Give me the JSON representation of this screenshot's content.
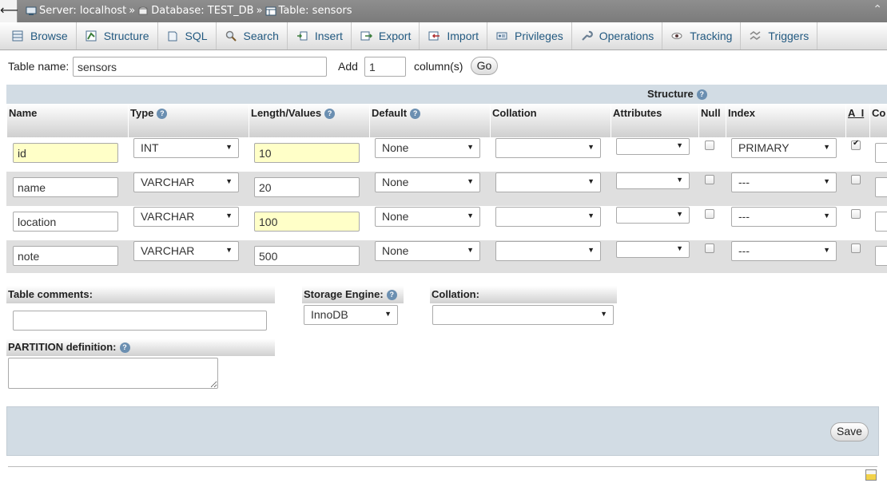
{
  "breadcrumb": {
    "server": "Server: localhost",
    "database": "Database: TEST_DB",
    "table": "Table: sensors",
    "sep": "»"
  },
  "tabs": [
    {
      "label": "Browse",
      "icon": "browse-icon"
    },
    {
      "label": "Structure",
      "icon": "structure-icon"
    },
    {
      "label": "SQL",
      "icon": "sql-icon"
    },
    {
      "label": "Search",
      "icon": "search-icon"
    },
    {
      "label": "Insert",
      "icon": "insert-icon"
    },
    {
      "label": "Export",
      "icon": "export-icon"
    },
    {
      "label": "Import",
      "icon": "import-icon"
    },
    {
      "label": "Privileges",
      "icon": "privileges-icon"
    },
    {
      "label": "Operations",
      "icon": "operations-icon"
    },
    {
      "label": "Tracking",
      "icon": "tracking-icon"
    },
    {
      "label": "Triggers",
      "icon": "triggers-icon"
    }
  ],
  "table_name": {
    "label": "Table name:",
    "value": "sensors",
    "add_label": "Add",
    "add_count": "1",
    "columns_label": "column(s)",
    "go_label": "Go"
  },
  "structure": {
    "caption": "Structure",
    "headers": {
      "name": "Name",
      "type": "Type",
      "length": "Length/Values",
      "default": "Default",
      "collation": "Collation",
      "attributes": "Attributes",
      "null": "Null",
      "index": "Index",
      "ai": "A_I",
      "comments": "Co"
    },
    "rows": [
      {
        "name": "id",
        "type": "INT",
        "length": "10",
        "default": "None",
        "collation": "",
        "attributes": "",
        "null": false,
        "index": "PRIMARY",
        "ai": true
      },
      {
        "name": "name",
        "type": "VARCHAR",
        "length": "20",
        "default": "None",
        "collation": "",
        "attributes": "",
        "null": false,
        "index": "---",
        "ai": false
      },
      {
        "name": "location",
        "type": "VARCHAR",
        "length": "100",
        "default": "None",
        "collation": "",
        "attributes": "",
        "null": false,
        "index": "---",
        "ai": false
      },
      {
        "name": "note",
        "type": "VARCHAR",
        "length": "500",
        "default": "None",
        "collation": "",
        "attributes": "",
        "null": false,
        "index": "---",
        "ai": false
      }
    ]
  },
  "table_comments": {
    "label": "Table comments:",
    "value": ""
  },
  "storage_engine": {
    "label": "Storage Engine:",
    "value": "InnoDB"
  },
  "collation": {
    "label": "Collation:",
    "value": ""
  },
  "partition": {
    "label": "PARTITION definition:",
    "value": ""
  },
  "save_label": "Save",
  "colors": {
    "accent": "#235a81",
    "highlight": "#ffffc8",
    "panel": "#d2dce4"
  }
}
